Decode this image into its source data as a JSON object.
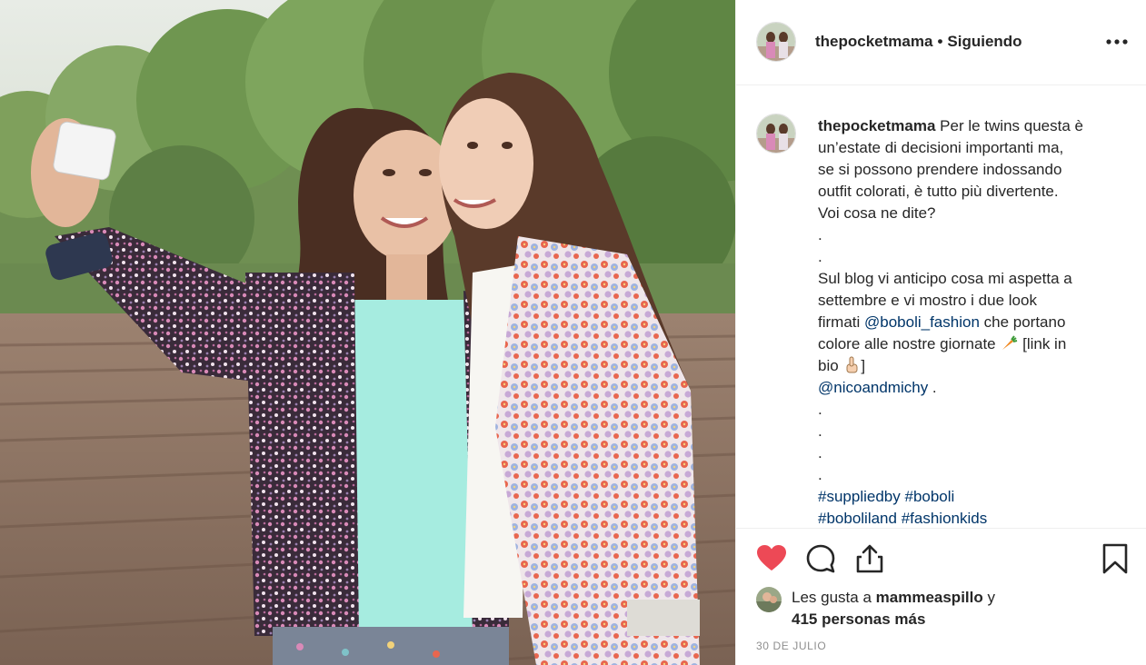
{
  "header": {
    "username": "thepocketmama",
    "separator": "•",
    "follow_status": "Siguiendo"
  },
  "caption": {
    "username": "thepocketmama",
    "lines": [
      "Per le twins questa è",
      "un’estate di decisioni importanti ma,",
      "se si possono prendere indossando",
      "outfit colorati, è tutto più divertente.",
      "Voi cosa ne dite?",
      ".",
      ".",
      "Sul blog vi anticipo cosa mi aspetta a",
      "settembre e vi mostro i due look"
    ],
    "line_firmati_prefix": "firmati ",
    "mention_brand": "@boboli_fashion",
    "line_firmati_suffix": " che portano",
    "line_colore": "colore alle nostre giornate",
    "link_text_1": "[link in",
    "link_text_2": "bio",
    "link_text_3": "]",
    "mention_twins": "@nicoandmichy",
    "mention_twins_suffix": " .",
    "dots_after": [
      ".",
      ".",
      ".",
      "."
    ],
    "hashtags_line1": [
      "#suppliedby",
      "#boboli"
    ],
    "hashtags_line2": [
      "#boboliland",
      "#fashionkids"
    ],
    "emoji_1": "carrot-emoji",
    "emoji_2": "pointing-up-emoji"
  },
  "actions": {
    "like_icon": "heart-filled-icon",
    "comment_icon": "comment-icon",
    "share_icon": "share-icon",
    "save_icon": "bookmark-icon",
    "like_color": "#ed4956"
  },
  "likes": {
    "prefix": "Les gusta a",
    "liker": "mammeaspillo",
    "conjunction": "y",
    "others": "415 personas más"
  },
  "date": "30 DE JULIO",
  "colors": {
    "link": "#003569",
    "text": "#262626",
    "muted": "#8e8e8e",
    "border": "#efefef"
  }
}
